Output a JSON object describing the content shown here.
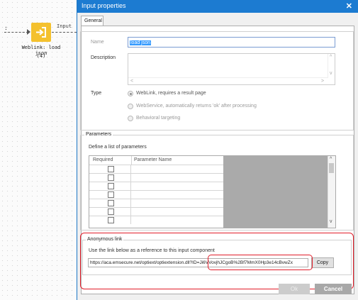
{
  "canvas": {
    "connector_colon": ":",
    "node_output_label": "Input",
    "node_title": "Weblink: load json",
    "node_count": "(4)",
    "node_color": "#f4c12e"
  },
  "dialog": {
    "title": "Input properties",
    "close_glyph": "✕",
    "tab_general": "General",
    "name_label": "Name",
    "name_value": "load json",
    "description_label": "Description",
    "desc_scroll_up": "^",
    "desc_scroll_down": "v",
    "desc_scroll_left": "<",
    "desc_scroll_right": ">",
    "type_label": "Type",
    "type_options": [
      {
        "label": "WebLink, requires a result page",
        "selected": true
      },
      {
        "label": "WebService, automatically returns 'ok' after processing",
        "selected": false
      },
      {
        "label": "Behavioral targeting",
        "selected": false
      }
    ],
    "parameters": {
      "group_title": "Parameters",
      "define_label": "Define a list of parameters",
      "col_required": "Required",
      "col_parameter_name": "Parameter Name",
      "scroll_up": "^",
      "scroll_down": "v"
    },
    "anonymous_link": {
      "group_title": "Anonymous link",
      "description": "Use the link below as a reference to this input component",
      "url": "https://aca.emsecure.net/optiext/optiextension.dll?ID=Ji6VVovjhJCgoB%2Bf7MmX0Hp3e14cBvwZx",
      "copy_label": "Copy"
    },
    "ok_label": "Ok",
    "cancel_label": "Cancel",
    "highlight_color": "#e21d2a",
    "titlebar_color": "#1c7bd1"
  }
}
